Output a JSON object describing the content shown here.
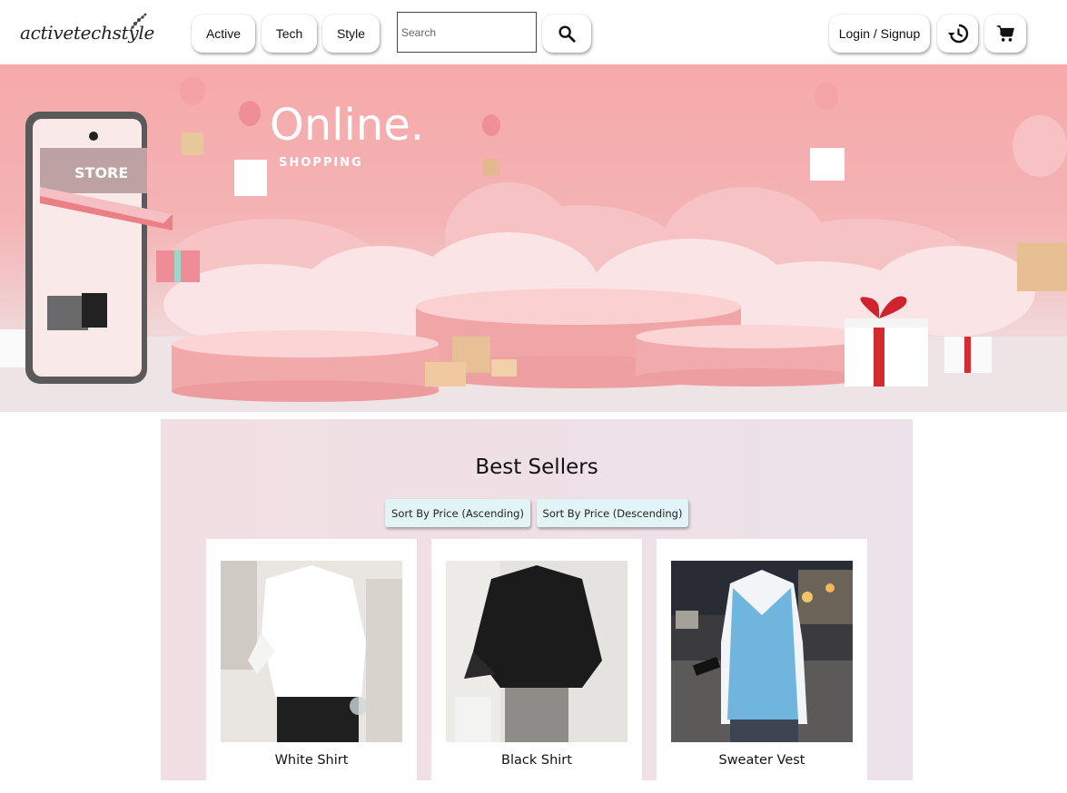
{
  "brand": {
    "logo_text": "activetechstyle"
  },
  "nav": {
    "categories": [
      "Active",
      "Tech",
      "Style"
    ],
    "search_placeholder": "Search",
    "login_label": "Login / Signup"
  },
  "icons": {
    "search": "search-icon",
    "history": "history-icon",
    "cart": "cart-icon"
  },
  "banner": {
    "headline": "Online.",
    "subheadline": "SHOPPING",
    "store_sign": "STORE"
  },
  "best_sellers": {
    "title": "Best Sellers",
    "sort_asc_label": "Sort By Price (Ascending)",
    "sort_desc_label": "Sort By Price (Descending)",
    "products": [
      {
        "name": "White Shirt"
      },
      {
        "name": "Black Shirt"
      },
      {
        "name": "Sweater Vest"
      }
    ]
  },
  "colors": {
    "banner_pink": "#f6a9aa",
    "sort_button_bg": "#e2f4f5",
    "section_bg": "#f2dfe3"
  }
}
